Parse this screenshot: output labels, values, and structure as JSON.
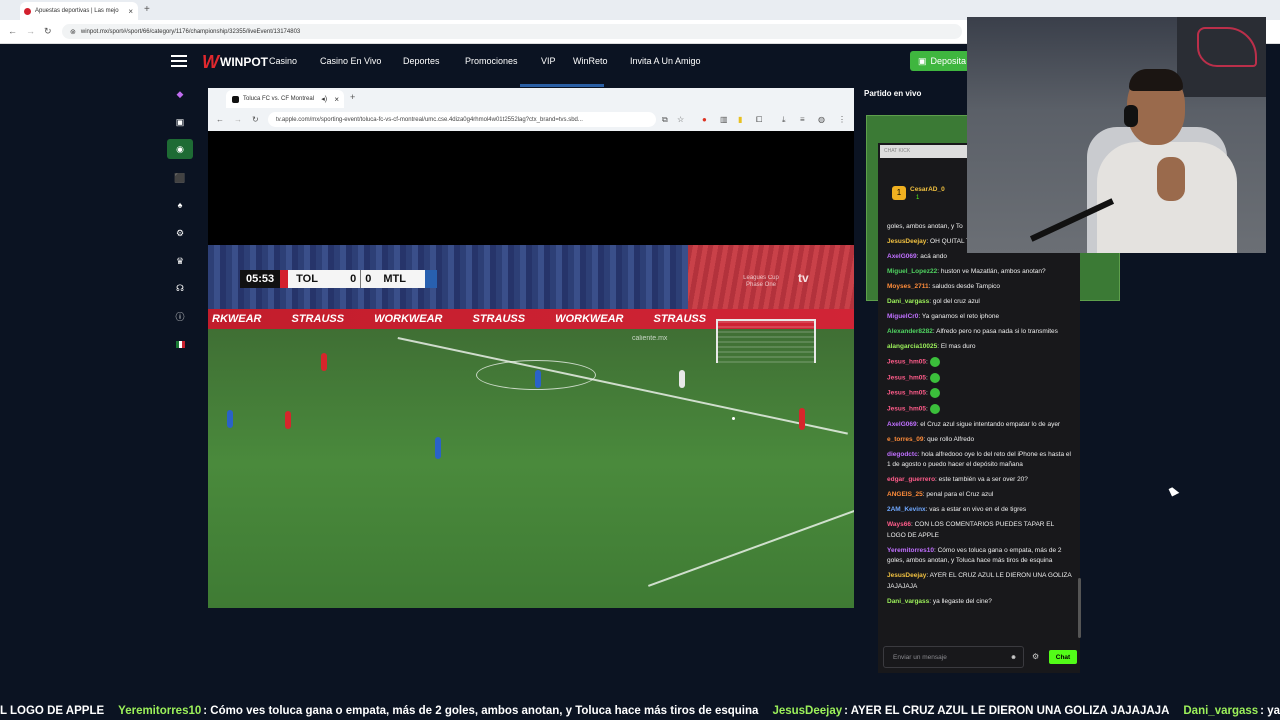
{
  "outer_browser": {
    "tab_title": "Apuestas deportivas | Las mejo",
    "url": "winpot.mx/sport#/sport/66/category/1176/championship/32355/liveEvent/13174803"
  },
  "site": {
    "logo": "WINPOT",
    "nav": [
      "Casino",
      "Casino En Vivo",
      "Deportes",
      "Promociones",
      "VIP",
      "WinReto",
      "Invita A Un Amigo"
    ],
    "deposit_label": "Deposita",
    "live_heading": "Partido en vivo"
  },
  "inner_browser": {
    "tab_title": "Toluca FC vs. CF Montreal",
    "url": "tv.apple.com/mx/sporting-event/toluca-fc-vs-cf-montreal/umc.cse.4diza0g4rhmol4w01t2552lag?ctx_brand=tvs.sbd..."
  },
  "scoreboard": {
    "clock": "05:53",
    "team1": "TOL",
    "score1": "0",
    "score2": "0",
    "team2": "MTL",
    "team1_color": "#d3202e",
    "team2_color": "#2860b0"
  },
  "broadcast": {
    "watermark": "tv",
    "league": "Leagues Cup Phase One",
    "ad_words": [
      "RKWEAR",
      "STRAUSS",
      "WORKWEAR",
      "STRAUSS",
      "WORKWEAR",
      "STRAUSS"
    ],
    "sponsor": "caliente.mx"
  },
  "chat": {
    "header": "CHAT KICK",
    "viewer_name": "CesarAD_0",
    "viewer_count": "1",
    "messages": [
      {
        "user": "",
        "text": "goles, ambos anotan, y To",
        "color": "#efefef"
      },
      {
        "user": "JesusDeejay",
        "text": "OH QUITAL TENGAS PROBLEMA",
        "color": "#f0c040"
      },
      {
        "user": "AxelG069",
        "text": "acá ando",
        "color": "#c070ff"
      },
      {
        "user": "Miguel_Lopez22",
        "text": "huston ve Mazatlán, ambos anotan?",
        "color": "#4fd160"
      },
      {
        "user": "Moyses_2711",
        "text": "saludos desde Tampico",
        "color": "#ff8c3a"
      },
      {
        "user": "Dani_vargass",
        "text": "gol del cruz azul",
        "color": "#9cf05a"
      },
      {
        "user": "MiguelCr0",
        "text": "Ya ganamos el reto iphone",
        "color": "#c070ff"
      },
      {
        "user": "Alexander8282",
        "text": "Alfredo pero no pasa nada si lo transmites",
        "color": "#4fd160"
      },
      {
        "user": "alangarcia10025",
        "text": "El mas duro",
        "color": "#9cf05a"
      },
      {
        "user": "Jesus_hm05",
        "text": "",
        "color": "#ff5c8a",
        "emote": true
      },
      {
        "user": "Jesus_hm05",
        "text": "",
        "color": "#ff5c8a",
        "emote": true
      },
      {
        "user": "Jesus_hm05",
        "text": "",
        "color": "#ff5c8a",
        "emote": true
      },
      {
        "user": "Jesus_hm05",
        "text": "",
        "color": "#ff5c8a",
        "emote": true
      },
      {
        "user": "AxelG069",
        "text": "el Cruz azul sigue intentando empatar lo de ayer",
        "color": "#c070ff"
      },
      {
        "user": "e_torres_09",
        "text": "que rollo Alfredo",
        "color": "#ff8c3a"
      },
      {
        "user": "diegodctc",
        "text": "hola alfredooo oye lo del reto del iPhone es hasta el 1 de agosto o puedo hacer el depósito mañana",
        "color": "#c070ff"
      },
      {
        "user": "edgar_guerrero",
        "text": "este también va a ser over 20?",
        "color": "#ff5c8a"
      },
      {
        "user": "ANGEIS_25",
        "text": "penal para el Cruz azul",
        "color": "#ff8c3a"
      },
      {
        "user": "2AM_Kevinx",
        "text": "vas a estar en vivo en el de tigres",
        "color": "#6fa8ff"
      },
      {
        "user": "Ways66",
        "text": "CON LOS COMENTARIOS PUEDES TAPAR EL LOGO DE APPLE",
        "color": "#ff5c8a"
      },
      {
        "user": "Yeremitorres10",
        "text": "Cómo ves toluca gana o empata, más de 2 goles, ambos anotan, y Toluca hace más tiros de esquina",
        "color": "#c070ff"
      },
      {
        "user": "JesusDeejay",
        "text": "AYER EL CRUZ AZUL LE DIERON UNA GOLIZA JAJAJAJA",
        "color": "#f0c040"
      },
      {
        "user": "Dani_vargass",
        "text": "ya llegaste del cine?",
        "color": "#9cf05a"
      }
    ],
    "input_placeholder": "Enviar un mensaje",
    "send_label": "Chat"
  },
  "ticker": [
    {
      "user": "",
      "text": "L LOGO DE APPLE"
    },
    {
      "user": "Yeremitorres10",
      "text": ": Cómo ves toluca gana o empata, más de 2 goles, ambos anotan, y Toluca hace más tiros de esquina"
    },
    {
      "user": "JesusDeejay",
      "text": ": AYER EL CRUZ AZUL LE DIERON UNA GOLIZA JAJAJAJA"
    },
    {
      "user": "Dani_vargass",
      "text": ": ya llegaste del cine?"
    }
  ]
}
